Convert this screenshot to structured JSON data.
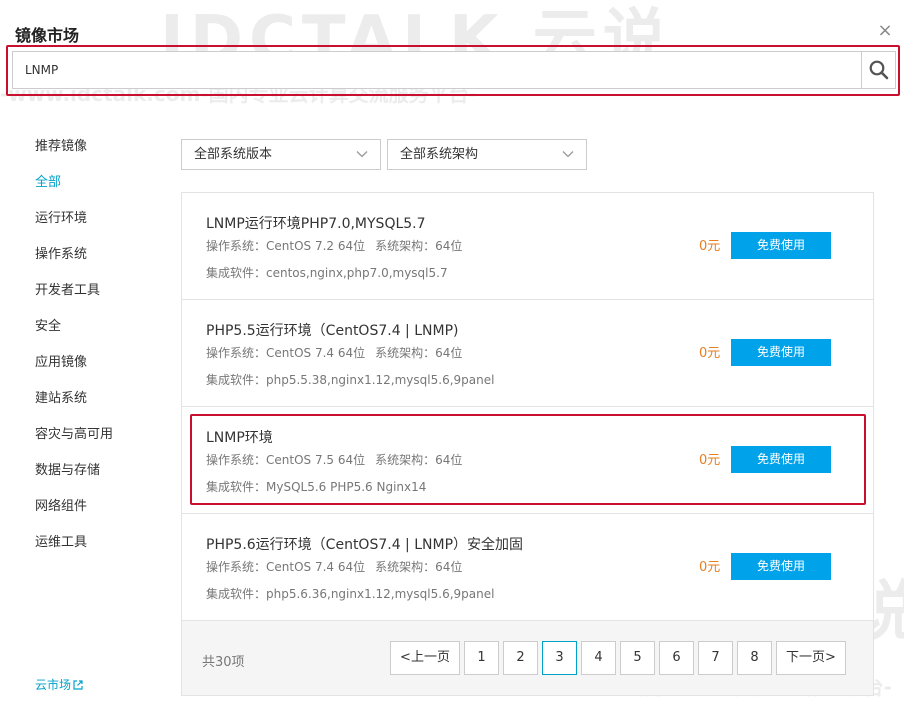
{
  "dialog": {
    "title": "镜像市场",
    "close": "×"
  },
  "search": {
    "value": "LNMP",
    "placeholder": ""
  },
  "sidebar": {
    "items": [
      {
        "label": "推荐镜像",
        "active": false
      },
      {
        "label": "全部",
        "active": true
      },
      {
        "label": "运行环境",
        "active": false
      },
      {
        "label": "操作系统",
        "active": false
      },
      {
        "label": "开发者工具",
        "active": false
      },
      {
        "label": "安全",
        "active": false
      },
      {
        "label": "应用镜像",
        "active": false
      },
      {
        "label": "建站系统",
        "active": false
      },
      {
        "label": "容灾与高可用",
        "active": false
      },
      {
        "label": "数据与存储",
        "active": false
      },
      {
        "label": "网络组件",
        "active": false
      },
      {
        "label": "运维工具",
        "active": false
      }
    ],
    "footer": "云市场"
  },
  "filters": {
    "version": "全部系统版本",
    "arch": "全部系统架构"
  },
  "images": [
    {
      "name": "LNMP运行环境PHP7.0,MYSQL5.7",
      "os": "操作系统：CentOS 7.2 64位",
      "arch": "系统架构：64位",
      "software": "集成软件：centos,nginx,php7.0,mysql5.7",
      "price": "0元",
      "button": "免费使用"
    },
    {
      "name": "PHP5.5运行环境（CentOS7.4 | LNMP)",
      "os": "操作系统：CentOS 7.4 64位",
      "arch": "系统架构：64位",
      "software": "集成软件：php5.5.38,nginx1.12,mysql5.6,9panel",
      "price": "0元",
      "button": "免费使用"
    },
    {
      "name": "LNMP环境",
      "os": "操作系统：CentOS 7.5 64位",
      "arch": "系统架构：64位",
      "software": "集成软件：MySQL5.6 PHP5.6 Nginx14",
      "price": "0元",
      "button": "免费使用"
    },
    {
      "name": "PHP5.6运行环境（CentOS7.4 | LNMP）安全加固",
      "os": "操作系统：CentOS 7.4 64位",
      "arch": "系统架构：64位",
      "software": "集成软件：php5.6.36,nginx1.12,mysql5.6,9panel",
      "price": "0元",
      "button": "免费使用"
    }
  ],
  "pagination": {
    "total": "共30项",
    "prev": "<上一页",
    "next": "下一页>",
    "pages": [
      "1",
      "2",
      "3",
      "4",
      "5",
      "6",
      "7",
      "8"
    ],
    "current": "3"
  },
  "watermark": {
    "brand": "IDCTALK 云说",
    "url": "-www.idctalk.com-国内专业云计算交流服务平台-"
  },
  "colors": {
    "accent": "#00a2ca",
    "button": "#00a2ea",
    "price": "#e67e22",
    "highlight": "#c8102e"
  },
  "icons": {
    "search": "search-icon",
    "close": "close-icon",
    "dropdown": "chevron-down-icon",
    "external": "external-link-icon"
  }
}
